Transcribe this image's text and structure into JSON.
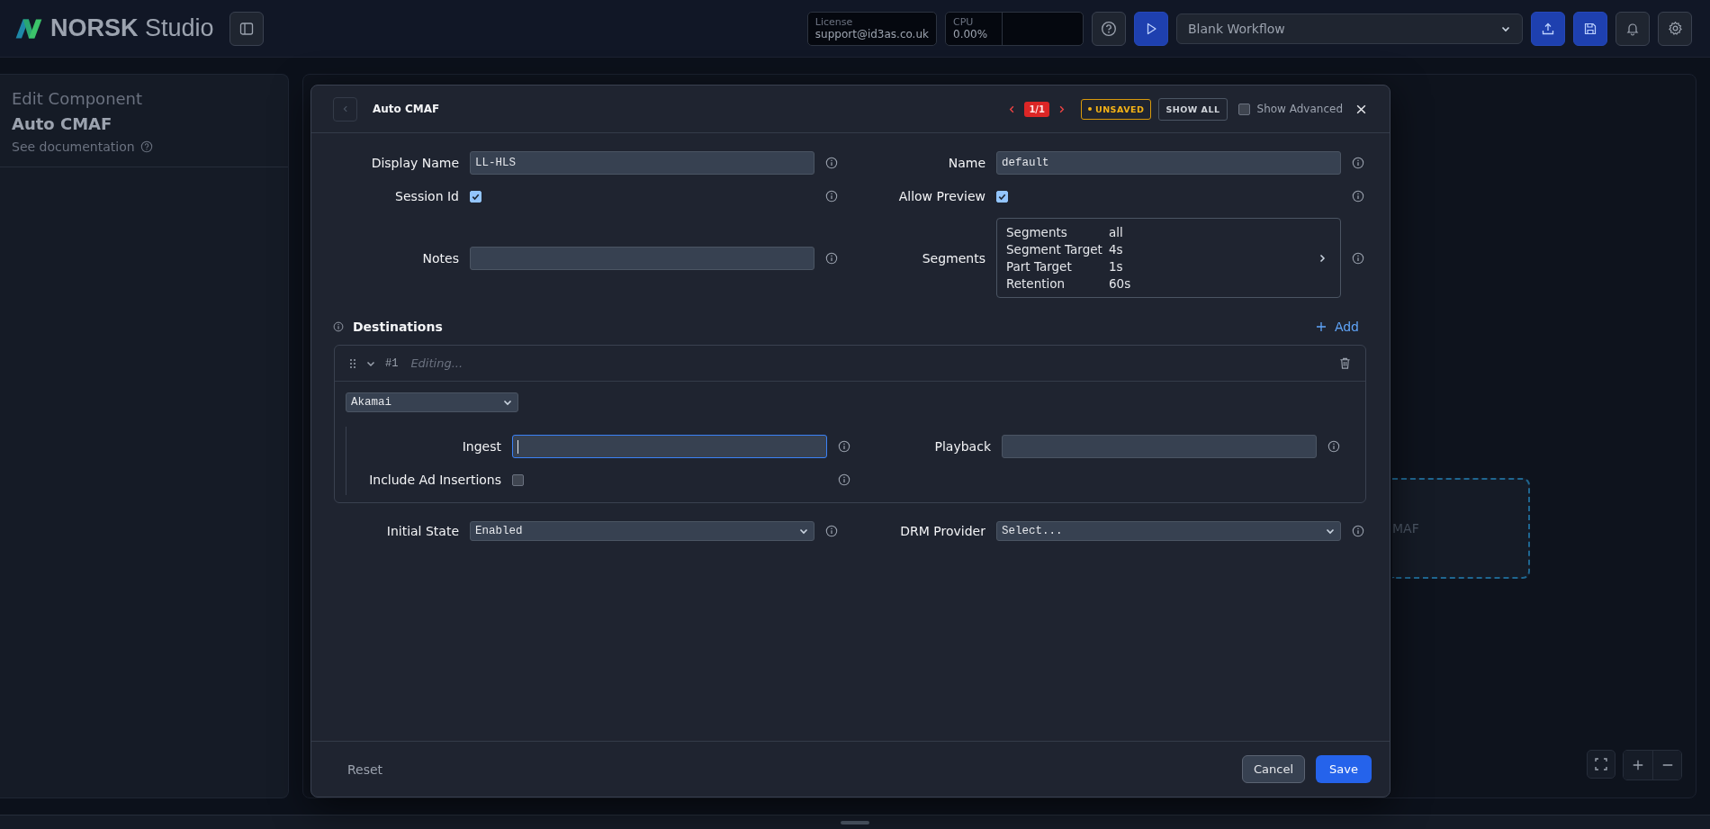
{
  "app": {
    "logo_name": "NORSK",
    "logo_suffix": "Studio"
  },
  "header": {
    "license_label": "License",
    "license_value": "support@id3as.co.uk",
    "cpu_label": "CPU",
    "cpu_value": "0.00%",
    "workflow": "Blank Workflow"
  },
  "sidebar": {
    "title": "Edit Component",
    "component": "Auto CMAF",
    "doc_link": "See documentation"
  },
  "canvas": {
    "node_label": "MAF"
  },
  "modal": {
    "title": "Auto CMAF",
    "counter": "1/1",
    "status": "UNSAVED",
    "show_all": "SHOW ALL",
    "show_advanced": {
      "label": "Show Advanced",
      "checked": false
    },
    "fields": [
      {
        "kind": "text",
        "label": "Display Name",
        "value": "LL-HLS"
      },
      {
        "kind": "text",
        "label": "Name",
        "value": "default"
      },
      {
        "kind": "checkbox",
        "label": "Session Id",
        "checked": true
      },
      {
        "kind": "checkbox",
        "label": "Allow Preview",
        "checked": true
      },
      {
        "kind": "text",
        "label": "Notes"
      },
      {
        "kind": "summary",
        "label": "Segments",
        "rows": [
          {
            "key": "Segments",
            "value": "all"
          },
          {
            "key": "Segment Target",
            "value": "4s"
          },
          {
            "key": "Part Target",
            "value": "1s"
          },
          {
            "key": "Retention",
            "value": "60s"
          }
        ]
      }
    ],
    "destinations": {
      "label": "Destinations",
      "add_label": "Add",
      "items": [
        {
          "number": "#1",
          "status": "Editing...",
          "expanded": true,
          "provider": "Akamai",
          "fields": [
            {
              "kind": "text",
              "label": "Ingest",
              "focused": true
            },
            {
              "kind": "text",
              "label": "Playback",
              "focused": false
            },
            {
              "kind": "checkbox",
              "label": "Include Ad Insertions",
              "checked": false
            }
          ]
        }
      ]
    },
    "bottom_fields": [
      {
        "kind": "select",
        "label": "Initial State",
        "value": "Enabled"
      },
      {
        "kind": "select",
        "label": "DRM Provider",
        "placeholder": "Select..."
      }
    ],
    "footer": {
      "reset": "Reset",
      "cancel": "Cancel",
      "save": "Save"
    }
  }
}
